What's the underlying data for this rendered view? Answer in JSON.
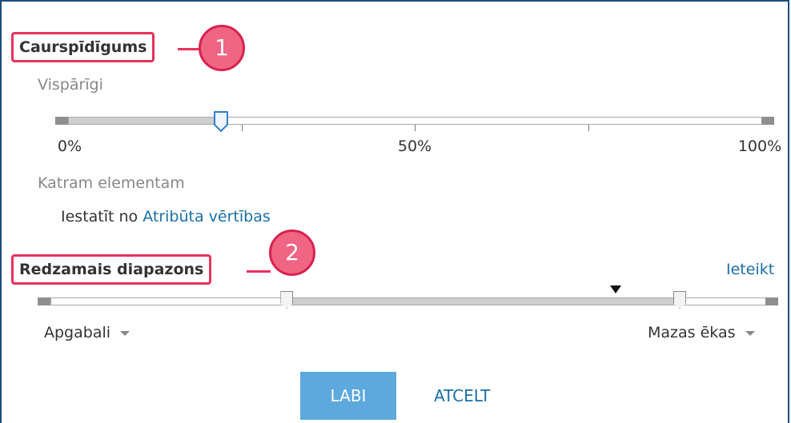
{
  "transparency": {
    "title": "Caurspīdīgums",
    "callout": "1",
    "general_label": "Vispārīgi",
    "value_percent": 22,
    "ticks": [
      "0%",
      "50%",
      "100%"
    ],
    "per_feature_label": "Katram elementam",
    "set_from_prefix": "Iestatīt no",
    "set_from_link": "Atribūta vērtības"
  },
  "visible_range": {
    "title": "Redzamais diapazons",
    "callout": "2",
    "set_link": "Ieteikt",
    "min_scale": "Apgabali",
    "max_scale": "Mazas ēkas",
    "min_fraction": 0.33,
    "max_fraction": 0.88,
    "current_fraction": 0.79
  },
  "buttons": {
    "ok": "LABI",
    "cancel": "ATCELT"
  },
  "colors": {
    "callout_border": "#e8315c",
    "link": "#1a6fa8",
    "primary_button": "#5da9dd"
  }
}
